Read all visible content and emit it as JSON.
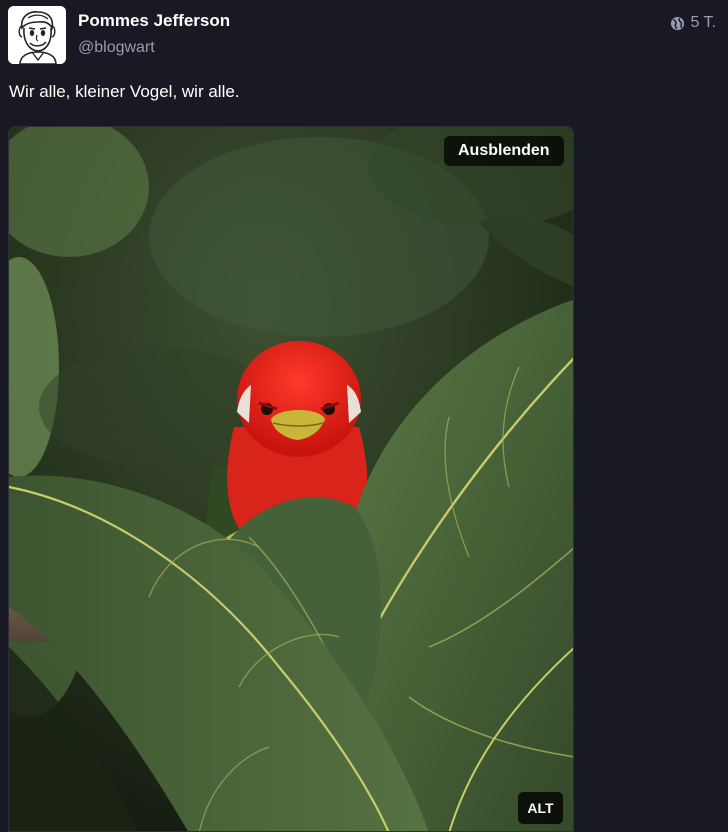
{
  "account": {
    "display_name": "Pommes Jefferson",
    "handle": "@blogwart",
    "avatar_icon": "cartoon-man-avatar"
  },
  "post": {
    "visibility_icon": "globe-icon",
    "relative_time": "5 T.",
    "text": "Wir alle, kleiner Vogel, wir alle."
  },
  "media": {
    "hide_label": "Ausblenden",
    "alt_label": "ALT"
  },
  "colors": {
    "background": "#191924",
    "muted_text": "#9a9ab2",
    "bird_red": "#e0241a",
    "leaf_green": "#4a6b3a"
  }
}
